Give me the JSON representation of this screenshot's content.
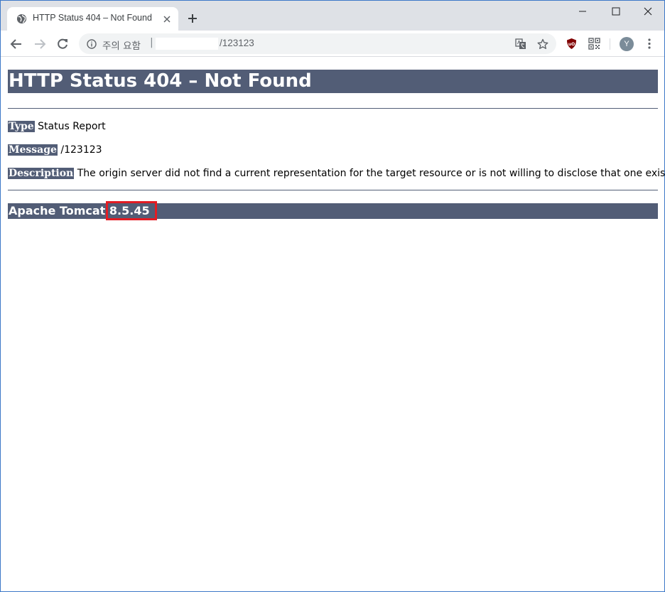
{
  "browser": {
    "tab": {
      "title": "HTTP Status 404 – Not Found"
    },
    "omnibox": {
      "security_label": "주의 요함",
      "separator": "|",
      "url_path": "/123123"
    },
    "profile_initial": "Y"
  },
  "page": {
    "heading": "HTTP Status 404 – Not Found",
    "fields": [
      {
        "label": "Type",
        "value": "Status Report"
      },
      {
        "label": "Message",
        "value": "/123123"
      },
      {
        "label": "Description",
        "value": "The origin server did not find a current representation for the target resource or is not willing to disclose that one exists."
      }
    ],
    "server_name": "Apache Tomcat",
    "server_version": "8.5.45"
  },
  "colors": {
    "tomcat_header": "#525d76",
    "highlight": "#e31c23",
    "tabbar": "#dee1e6"
  },
  "icons": [
    "globe-icon",
    "close-icon",
    "plus-icon",
    "minimize-icon",
    "maximize-icon",
    "back-icon",
    "forward-icon",
    "reload-icon",
    "info-icon",
    "translate-icon",
    "star-icon",
    "ublock-icon",
    "qr-code-icon",
    "kebab-menu-icon"
  ]
}
